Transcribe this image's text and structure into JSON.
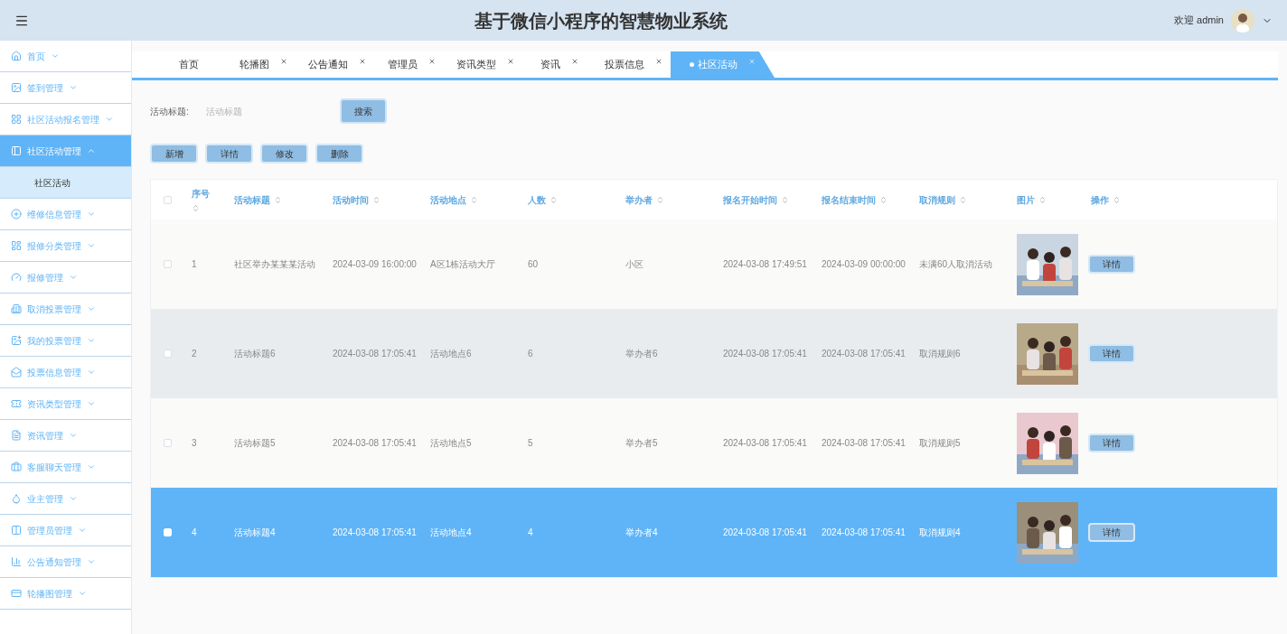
{
  "header": {
    "title": "基于微信小程序的智慧物业系统",
    "welcome": "欢迎 admin"
  },
  "sidebar": {
    "items": [
      {
        "label": "首页",
        "expanded": false,
        "selected": false
      },
      {
        "label": "签到管理",
        "expanded": false,
        "selected": false
      },
      {
        "label": "社区活动报名管理",
        "expanded": false,
        "selected": false
      },
      {
        "label": "社区活动管理",
        "expanded": true,
        "selected": true,
        "children": [
          {
            "label": "社区活动"
          }
        ]
      },
      {
        "label": "维修信息管理",
        "expanded": false,
        "selected": false
      },
      {
        "label": "报修分类管理",
        "expanded": false,
        "selected": false
      },
      {
        "label": "报修管理",
        "expanded": false,
        "selected": false
      },
      {
        "label": "取消投票管理",
        "expanded": false,
        "selected": false
      },
      {
        "label": "我的投票管理",
        "expanded": false,
        "selected": false
      },
      {
        "label": "投票信息管理",
        "expanded": false,
        "selected": false
      },
      {
        "label": "资讯类型管理",
        "expanded": false,
        "selected": false
      },
      {
        "label": "资讯管理",
        "expanded": false,
        "selected": false
      },
      {
        "label": "客服聊天管理",
        "expanded": false,
        "selected": false
      },
      {
        "label": "业主管理",
        "expanded": false,
        "selected": false
      },
      {
        "label": "管理员管理",
        "expanded": false,
        "selected": false
      },
      {
        "label": "公告通知管理",
        "expanded": false,
        "selected": false
      },
      {
        "label": "轮播图管理",
        "expanded": false,
        "selected": false
      }
    ]
  },
  "tabs": [
    {
      "label": "首页",
      "closable": false,
      "selected": false
    },
    {
      "label": "轮播图",
      "closable": true,
      "selected": false
    },
    {
      "label": "公告通知",
      "closable": true,
      "selected": false
    },
    {
      "label": "管理员",
      "closable": true,
      "selected": false
    },
    {
      "label": "资讯类型",
      "closable": true,
      "selected": false
    },
    {
      "label": "资讯",
      "closable": true,
      "selected": false
    },
    {
      "label": "投票信息",
      "closable": true,
      "selected": false
    },
    {
      "label": "社区活动",
      "closable": true,
      "selected": true
    }
  ],
  "search": {
    "label": "活动标题:",
    "placeholder": "活动标题",
    "button": "搜索"
  },
  "actions": [
    "新增",
    "详情",
    "修改",
    "删除"
  ],
  "table": {
    "select_all_checked": false,
    "columns": [
      "序号",
      "活动标题",
      "活动时间",
      "活动地点",
      "人数",
      "举办者",
      "报名开始时间",
      "报名结束时间",
      "取消规则",
      "图片",
      "操作"
    ],
    "rows": [
      {
        "selected": false,
        "striped": false,
        "cells": [
          "1",
          "社区举办某某某活动",
          "2024-03-09 16:00:00",
          "A区1栋活动大厅",
          "60",
          "小区",
          "2024-03-08 17:49:51",
          "2024-03-09 00:00:00",
          "未满60人取消活动"
        ],
        "button": "详情"
      },
      {
        "selected": false,
        "striped": true,
        "cells": [
          "2",
          "活动标题6",
          "2024-03-08 17:05:41",
          "活动地点6",
          "6",
          "举办者6",
          "2024-03-08 17:05:41",
          "2024-03-08 17:05:41",
          "取消规则6"
        ],
        "button": "详情"
      },
      {
        "selected": false,
        "striped": false,
        "cells": [
          "3",
          "活动标题5",
          "2024-03-08 17:05:41",
          "活动地点5",
          "5",
          "举办者5",
          "2024-03-08 17:05:41",
          "2024-03-08 17:05:41",
          "取消规则5"
        ],
        "button": "详情"
      },
      {
        "selected": true,
        "striped": false,
        "cells": [
          "4",
          "活动标题4",
          "2024-03-08 17:05:41",
          "活动地点4",
          "4",
          "举办者4",
          "2024-03-08 17:05:41",
          "2024-03-08 17:05:41",
          "取消规则4"
        ],
        "button": "详情"
      }
    ]
  }
}
